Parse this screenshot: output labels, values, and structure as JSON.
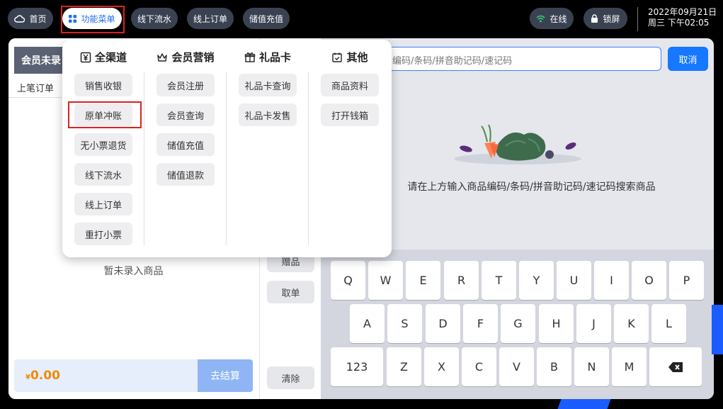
{
  "topbar": {
    "home": "首页",
    "function_menu": "功能菜单",
    "offline_flow": "线下流水",
    "online_orders": "线上订单",
    "stored_value_recharge": "储值充值",
    "online_status": "在线",
    "lock_screen": "锁屏",
    "date": "2022年09月21日",
    "weekday_time": "周三 下午02:05"
  },
  "left": {
    "member_header": "会员未录",
    "prev_order": "上笔订单",
    "empty_text": "暂未录入商品",
    "total_currency": "¥",
    "total_amount": "0.00",
    "checkout": "去结算"
  },
  "side_buttons": {
    "gift": "赠品",
    "take_order": "取单",
    "clear": "清除"
  },
  "search": {
    "placeholder": "编码/条码/拼音助记码/速记码",
    "cancel": "取消",
    "hint": "请在上方输入商品编码/条码/拼音助记码/速记码搜索商品"
  },
  "keyboard": {
    "row1": [
      "Q",
      "W",
      "E",
      "R",
      "T",
      "Y",
      "U",
      "I",
      "O",
      "P"
    ],
    "row2": [
      "A",
      "S",
      "D",
      "F",
      "G",
      "H",
      "J",
      "K",
      "L"
    ],
    "row3": [
      "123",
      "Z",
      "X",
      "C",
      "V",
      "B",
      "N",
      "M"
    ]
  },
  "menu": {
    "columns": [
      {
        "title": "全渠道",
        "items": [
          "销售收银",
          "原单冲账",
          "无小票退货",
          "线下流水",
          "线上订单",
          "重打小票"
        ]
      },
      {
        "title": "会员营销",
        "items": [
          "会员注册",
          "会员查询",
          "储值充值",
          "储值退款"
        ]
      },
      {
        "title": "礼品卡",
        "items": [
          "礼品卡查询",
          "礼品卡发售"
        ]
      },
      {
        "title": "其他",
        "items": [
          "商品资料",
          "打开钱箱"
        ]
      }
    ]
  },
  "colors": {
    "accent": "#1677ff",
    "highlight_border": "#e02020",
    "amount": "#f08a00"
  }
}
